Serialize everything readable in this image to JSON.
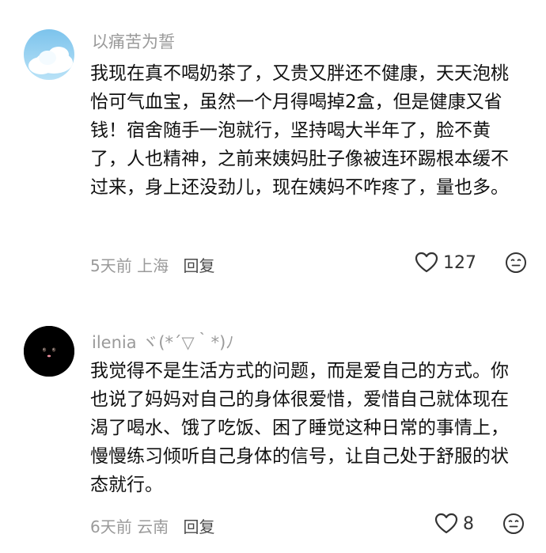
{
  "comments": [
    {
      "username": "以痛苦为誓",
      "text": "我现在真不喝奶茶了，又贵又胖还不健康，天天泡桃怡可气血宝，虽然一个月得喝掉2盒，但是健康又省钱！宿舍随手一泡就行，坚持喝大半年了，脸不黄了，人也精神，之前来姨妈肚子像被连环踢根本缓不过来，身上还没劲儿，现在姨妈不咋疼了，量也多。",
      "time": "5天前",
      "location": "上海",
      "reply_label": "回复",
      "likes": "127",
      "avatar_icon": "cloud-sky-avatar"
    },
    {
      "username": "ilenia ヾ(*´▽｀*)ﾉ",
      "text": "我觉得不是生活方式的问题，而是爱自己的方式。你也说了妈妈对自己的身体很爱惜，爱惜自己就体现在渴了喝水、饿了吃饭、困了睡觉这种日常的事情上，慢慢练习倾听自己身体的信号，让自己处于舒服的状态就行。",
      "time": "6天前",
      "location": "云南",
      "reply_label": "回复",
      "likes": "8",
      "avatar_icon": "black-cat-avatar"
    }
  ],
  "colors": {
    "meta_gray": "#9a9a9a",
    "body_text": "#111111",
    "reply_text": "#4a4a4a"
  }
}
